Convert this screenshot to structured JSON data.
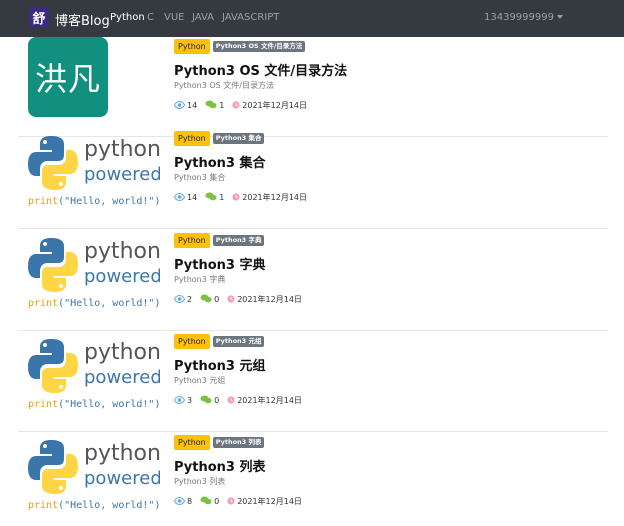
{
  "navbar": {
    "logo_char": "舒",
    "brand": "博客Blog",
    "links": [
      "Python",
      "C",
      "VUE",
      "JAVA",
      "JAVASCRIPT"
    ],
    "active_link": "Python",
    "user": "13439999999"
  },
  "colors": {
    "navbar_bg": "#343a40",
    "category_badge": "#ffc107",
    "sub_badge": "#6c757d",
    "views_icon": "#5aa9e6",
    "comments_icon": "#7cc242",
    "date_icon": "#f2a0b5"
  },
  "articles": [
    {
      "thumbnail": "hongfan-logo",
      "thumbnail_text": "洪凡",
      "category": "Python",
      "tag": "Python3 OS 文件/目录方法",
      "title": "Python3 OS 文件/目录方法",
      "description": "Python3 OS 文件/目录方法",
      "views": "14",
      "comments": "1",
      "date": "2021年12月14日"
    },
    {
      "thumbnail": "python-powered-logo",
      "category": "Python",
      "tag": "Python3 集合",
      "title": "Python3 集合",
      "description": "Python3 集合",
      "views": "14",
      "comments": "1",
      "date": "2021年12月14日"
    },
    {
      "thumbnail": "python-powered-logo",
      "category": "Python",
      "tag": "Python3 字典",
      "title": "Python3 字典",
      "description": "Python3 字典",
      "views": "2",
      "comments": "0",
      "date": "2021年12月14日"
    },
    {
      "thumbnail": "python-powered-logo",
      "category": "Python",
      "tag": "Python3 元组",
      "title": "Python3 元组",
      "description": "Python3 元组",
      "views": "3",
      "comments": "0",
      "date": "2021年12月14日"
    },
    {
      "thumbnail": "python-powered-logo",
      "category": "Python",
      "tag": "Python3 列表",
      "title": "Python3 列表",
      "description": "Python3 列表",
      "views": "8",
      "comments": "0",
      "date": "2021年12月14日"
    }
  ],
  "python_logo": {
    "line1": "python",
    "line2": "powered",
    "code_fn": "print",
    "code_str": "(\"Hello, world!\")"
  }
}
